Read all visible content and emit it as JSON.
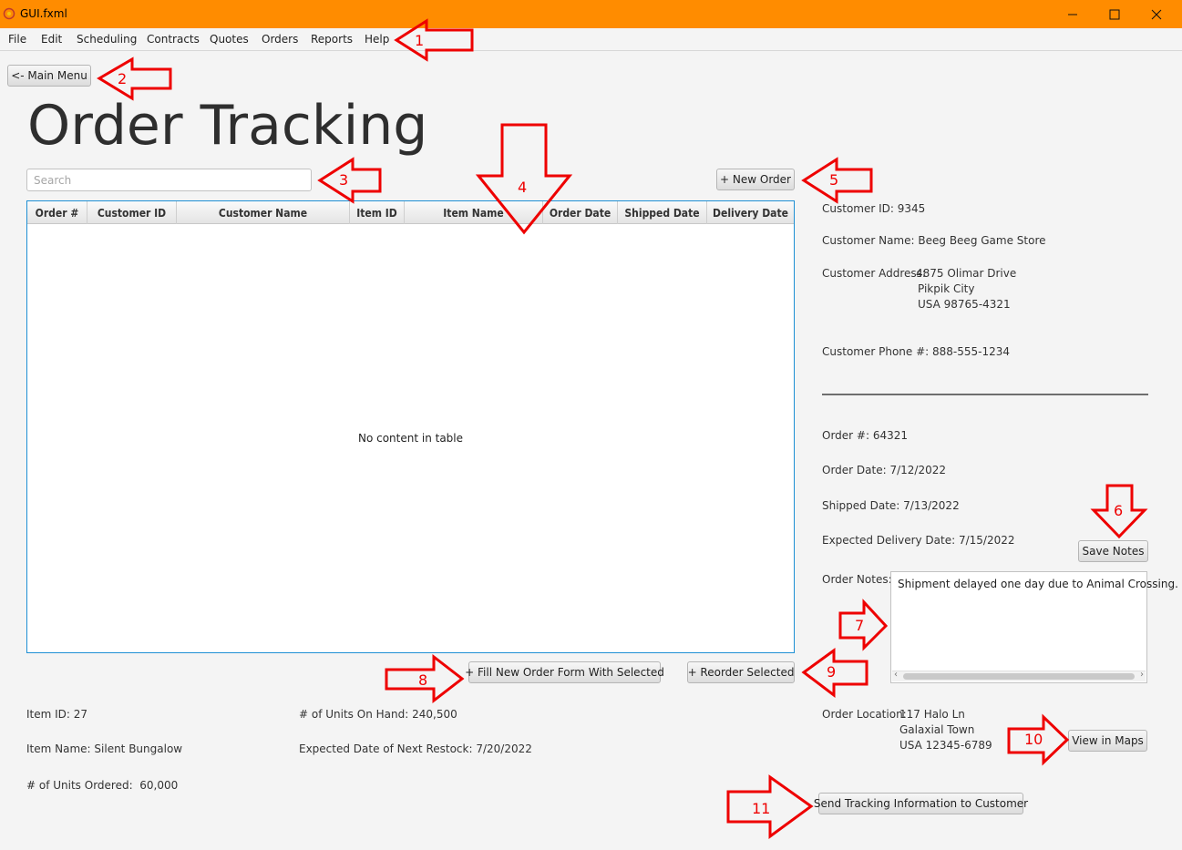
{
  "window": {
    "title": "GUI.fxml"
  },
  "menubar": {
    "items": [
      "File",
      "Edit",
      "Scheduling",
      "Contracts",
      "Quotes",
      "Orders",
      "Reports",
      "Help"
    ]
  },
  "nav": {
    "back_label": "<- Main Menu"
  },
  "page": {
    "title": "Order Tracking"
  },
  "search": {
    "placeholder": "Search",
    "value": ""
  },
  "buttons": {
    "new_order": "+ New Order",
    "save_notes": "Save Notes",
    "fill_new_order": "+ Fill New Order Form With Selected",
    "reorder_selected": "+ Reorder Selected",
    "view_in_maps": "View in Maps",
    "send_tracking": "Send Tracking Information to Customer"
  },
  "table": {
    "columns": [
      "Order #",
      "Customer ID",
      "Customer Name",
      "Item ID",
      "Item Name",
      "Order Date",
      "Shipped Date",
      "Delivery Date"
    ],
    "rows": [],
    "empty_text": "No content in table"
  },
  "customer": {
    "id_label": "Customer ID:",
    "id": "9345",
    "name_label": "Customer Name:",
    "name": "Beeg Beeg Game Store",
    "address_label": "Customer Address:",
    "address_line1": "4875 Olimar Drive",
    "address_line2": "Pikpik City",
    "address_line3": "USA 98765-4321",
    "phone_label": "Customer Phone #:",
    "phone": "888-555-1234"
  },
  "order": {
    "number_label": "Order #:",
    "number": "64321",
    "date_label": "Order Date:",
    "date": "7/12/2022",
    "shipped_label": "Shipped Date:",
    "shipped": "7/13/2022",
    "delivery_label": "Expected Delivery Date:",
    "delivery": "7/15/2022",
    "notes_label": "Order Notes:",
    "notes": "Shipment delayed one day due to Animal Crossing.",
    "location_label": "Order Location:",
    "location_line1": "117 Halo Ln",
    "location_line2": "Galaxial Town",
    "location_line3": "USA 12345-6789"
  },
  "item": {
    "id_label": "Item ID:",
    "id": "27",
    "name_label": "Item Name:",
    "name": "Silent Bungalow",
    "ordered_label": "# of Units Ordered:",
    "ordered": "60,000",
    "on_hand_label": "# of Units On Hand:",
    "on_hand": "240,500",
    "restock_label": "Expected Date of Next Restock:",
    "restock": "7/20/2022"
  },
  "callouts": [
    "1",
    "2",
    "3",
    "4",
    "5",
    "6",
    "7",
    "8",
    "9",
    "10",
    "11"
  ],
  "colors": {
    "titlebar": "#ff8c00",
    "table_border": "#1e8fd4",
    "callout": "#ee0000"
  }
}
